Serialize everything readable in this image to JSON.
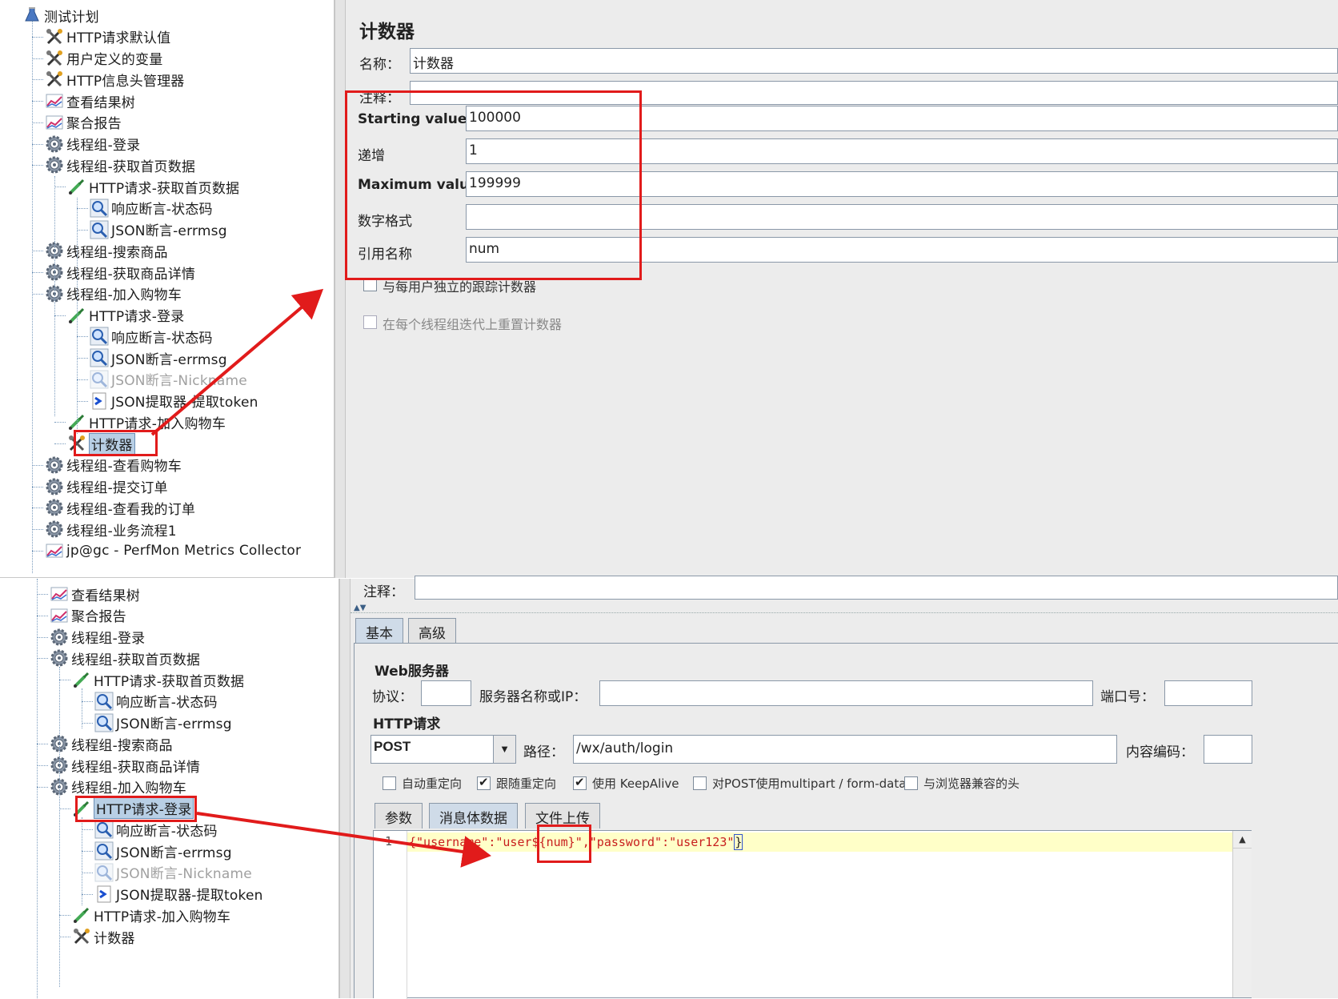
{
  "colors": {
    "highlight": "#e11b1b",
    "selection": "#b8cfe5",
    "code_bg": "#ffffd0"
  },
  "tree_top": {
    "items": [
      {
        "label": "测试计划",
        "icon": "flask-icon",
        "depth": 0
      },
      {
        "label": "HTTP请求默认值",
        "icon": "wrench-icon",
        "depth": 1
      },
      {
        "label": "用户定义的变量",
        "icon": "wrench-icon",
        "depth": 1
      },
      {
        "label": "HTTP信息头管理器",
        "icon": "wrench-icon",
        "depth": 1
      },
      {
        "label": "查看结果树",
        "icon": "graph-icon",
        "depth": 1
      },
      {
        "label": "聚合报告",
        "icon": "graph-icon",
        "depth": 1
      },
      {
        "label": "线程组-登录",
        "icon": "gear-icon",
        "depth": 1
      },
      {
        "label": "线程组-获取首页数据",
        "icon": "gear-icon",
        "depth": 1
      },
      {
        "label": "HTTP请求-获取首页数据",
        "icon": "pipette-icon",
        "depth": 2
      },
      {
        "label": "响应断言-状态码",
        "icon": "magnifier-icon",
        "depth": 3
      },
      {
        "label": "JSON断言-errmsg",
        "icon": "magnifier-icon",
        "depth": 3
      },
      {
        "label": "线程组-搜索商品",
        "icon": "gear-icon",
        "depth": 1
      },
      {
        "label": "线程组-获取商品详情",
        "icon": "gear-icon",
        "depth": 1
      },
      {
        "label": "线程组-加入购物车",
        "icon": "gear-icon",
        "depth": 1
      },
      {
        "label": "HTTP请求-登录",
        "icon": "pipette-icon",
        "depth": 2
      },
      {
        "label": "响应断言-状态码",
        "icon": "magnifier-icon",
        "depth": 3
      },
      {
        "label": "JSON断言-errmsg",
        "icon": "magnifier-icon",
        "depth": 3
      },
      {
        "label": "JSON断言-Nickname",
        "icon": "magnifier-icon",
        "depth": 3,
        "disabled": true
      },
      {
        "label": "JSON提取器-提取token",
        "icon": "arrow-doc-icon",
        "depth": 3
      },
      {
        "label": "HTTP请求-加入购物车",
        "icon": "pipette-icon",
        "depth": 2
      },
      {
        "label": "计数器",
        "icon": "wrench-icon",
        "depth": 2,
        "selected": true
      },
      {
        "label": "线程组-查看购物车",
        "icon": "gear-icon",
        "depth": 1
      },
      {
        "label": "线程组-提交订单",
        "icon": "gear-icon",
        "depth": 1
      },
      {
        "label": "线程组-查看我的订单",
        "icon": "gear-icon",
        "depth": 1
      },
      {
        "label": "线程组-业务流程1",
        "icon": "gear-icon",
        "depth": 1
      },
      {
        "label": "jp@gc - PerfMon Metrics Collector",
        "icon": "graph-icon",
        "depth": 1
      }
    ]
  },
  "counter_panel": {
    "title": "计数器",
    "name_label": "名称：",
    "name_value": "计数器",
    "comment_label": "注释：",
    "start_label": "Starting value",
    "start_value": "100000",
    "increment_label": "递增",
    "increment_value": "1",
    "max_label": "Maximum value",
    "max_value": "199999",
    "format_label": "数字格式",
    "format_value": "",
    "ref_label": "引用名称",
    "ref_value": "num",
    "per_user_label": "与每用户独立的跟踪计数器",
    "reset_label": "在每个线程组迭代上重置计数器"
  },
  "tree_bottom": {
    "items": [
      {
        "label": "查看结果树",
        "icon": "graph-icon",
        "depth": 1
      },
      {
        "label": "聚合报告",
        "icon": "graph-icon",
        "depth": 1
      },
      {
        "label": "线程组-登录",
        "icon": "gear-icon",
        "depth": 1
      },
      {
        "label": "线程组-获取首页数据",
        "icon": "gear-icon",
        "depth": 1
      },
      {
        "label": "HTTP请求-获取首页数据",
        "icon": "pipette-icon",
        "depth": 2
      },
      {
        "label": "响应断言-状态码",
        "icon": "magnifier-icon",
        "depth": 3
      },
      {
        "label": "JSON断言-errmsg",
        "icon": "magnifier-icon",
        "depth": 3
      },
      {
        "label": "线程组-搜索商品",
        "icon": "gear-icon",
        "depth": 1
      },
      {
        "label": "线程组-获取商品详情",
        "icon": "gear-icon",
        "depth": 1
      },
      {
        "label": "线程组-加入购物车",
        "icon": "gear-icon",
        "depth": 1
      },
      {
        "label": "HTTP请求-登录",
        "icon": "pipette-icon",
        "depth": 2,
        "selected": true
      },
      {
        "label": "响应断言-状态码",
        "icon": "magnifier-icon",
        "depth": 3
      },
      {
        "label": "JSON断言-errmsg",
        "icon": "magnifier-icon",
        "depth": 3
      },
      {
        "label": "JSON断言-Nickname",
        "icon": "magnifier-icon",
        "depth": 3,
        "disabled": true
      },
      {
        "label": "JSON提取器-提取token",
        "icon": "arrow-doc-icon",
        "depth": 3
      },
      {
        "label": "HTTP请求-加入购物车",
        "icon": "pipette-icon",
        "depth": 2
      },
      {
        "label": "计数器",
        "icon": "wrench-icon",
        "depth": 2
      }
    ]
  },
  "http_panel": {
    "comment_label": "注释：",
    "tabs": [
      "基本",
      "高级"
    ],
    "web_server_title": "Web服务器",
    "protocol_label": "协议：",
    "protocol_value": "",
    "server_label": "服务器名称或IP：",
    "server_value": "",
    "port_label": "端口号：",
    "port_value": "",
    "http_request_title": "HTTP请求",
    "method_value": "POST",
    "path_label": "路径：",
    "path_value": "/wx/auth/login",
    "encoding_label": "内容编码：",
    "encoding_value": "",
    "options": [
      {
        "label": "自动重定向",
        "checked": false
      },
      {
        "label": "跟随重定向",
        "checked": true
      },
      {
        "label": "使用 KeepAlive",
        "checked": true
      },
      {
        "label": "对POST使用multipart / form-data",
        "checked": false
      },
      {
        "label": "与浏览器兼容的头",
        "checked": false
      }
    ],
    "body_tabs": [
      "参数",
      "消息体数据",
      "文件上传"
    ],
    "line_number": "1",
    "code_prefix": "{\"username\":\"user",
    "code_var": "${num}",
    "code_suffix": "\",\"password\":\"user123\"",
    "code_close": "}"
  }
}
